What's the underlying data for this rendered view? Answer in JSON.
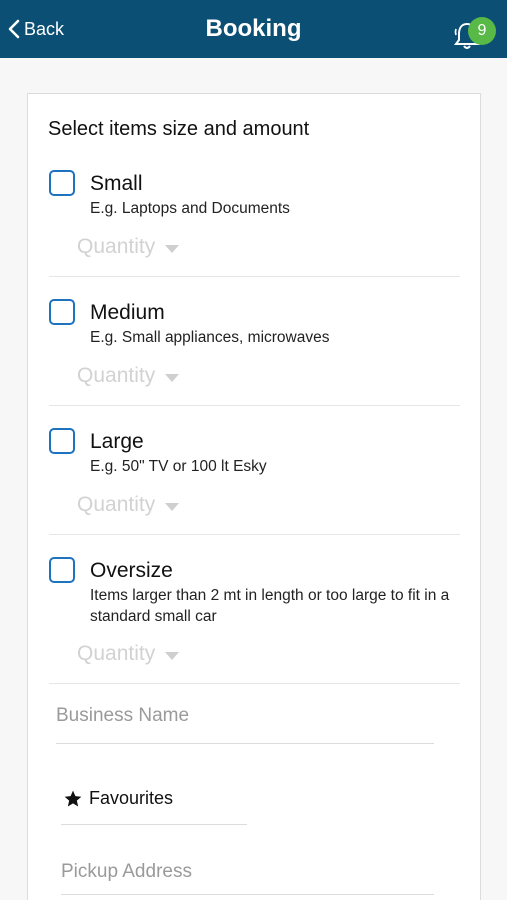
{
  "nav": {
    "back_label": "Back",
    "title": "Booking",
    "notification_count": "9",
    "background_color": "#0b4f74",
    "badge_color": "#58b947"
  },
  "form": {
    "section_title": "Select items size and amount",
    "items": [
      {
        "title": "Small",
        "description": "E.g. Laptops and Documents",
        "quantity_placeholder": "Quantity",
        "checked": false
      },
      {
        "title": "Medium",
        "description": "E.g. Small appliances, microwaves",
        "quantity_placeholder": "Quantity",
        "checked": false
      },
      {
        "title": "Large",
        "description": "E.g. 50\" TV or 100 lt Esky",
        "quantity_placeholder": "Quantity",
        "checked": false
      },
      {
        "title": "Oversize",
        "description": "Items larger than 2 mt in length or too large to fit in a standard small car",
        "quantity_placeholder": "Quantity",
        "checked": false
      }
    ],
    "business_name_placeholder": "Business Name",
    "favourites_label": "Favourites",
    "pickup_address_placeholder": "Pickup Address",
    "checkbox_color": "#1e73be"
  }
}
